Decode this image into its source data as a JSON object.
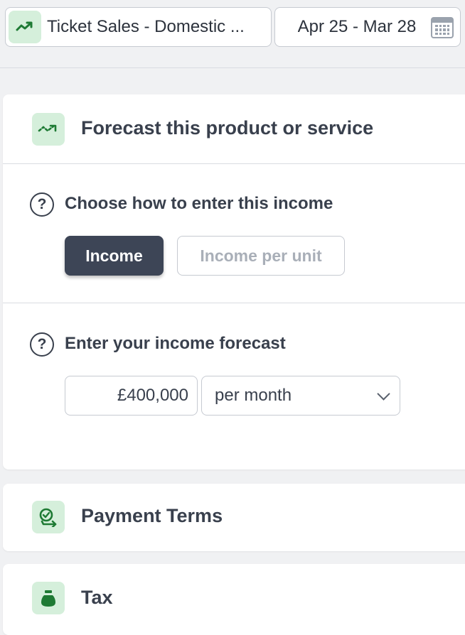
{
  "top_bar": {
    "product_name": "Ticket Sales - Domestic ...",
    "date_range": "Apr 25 - Mar 28"
  },
  "forecast_card": {
    "title": "Forecast this product or service",
    "entry_method": {
      "label": "Choose how to enter this income",
      "options": [
        "Income",
        "Income per unit"
      ],
      "selected": "Income"
    },
    "income_forecast": {
      "label": "Enter your income forecast",
      "amount": "£400,000",
      "period": "per month"
    }
  },
  "payment_terms_card": {
    "title": "Payment Terms"
  },
  "tax_card": {
    "title": "Tax"
  },
  "colors": {
    "accent_green": "#1e7a34",
    "icon_tile_bg": "#d5efdb",
    "active_button_bg": "#3d4556"
  },
  "icons": {
    "product": "trend-up-icon",
    "calendar": "calendar-icon",
    "forecast": "forecast-trend-icon",
    "help": "question-icon",
    "payment_terms": "clock-arrow-icon",
    "tax": "money-bag-icon",
    "dropdown": "chevron-down-icon"
  }
}
